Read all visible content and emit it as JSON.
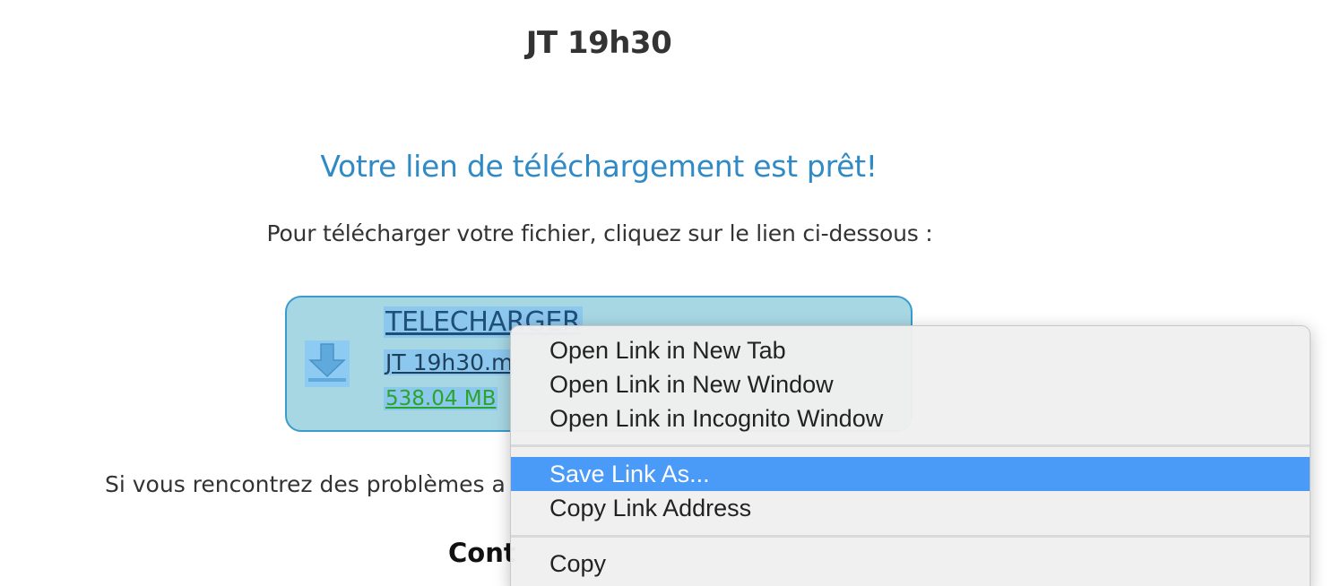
{
  "page": {
    "file_title": "JT 19h30",
    "ready_heading": "Votre lien de téléchargement est prêt!",
    "instructions": "Pour télécharger votre fichier, cliquez sur le lien ci-dessous :",
    "problems_text": "Si vous rencontrez des problèmes a",
    "contact_text": "Cont"
  },
  "download": {
    "link_label": "TELECHARGER",
    "file_name": "JT 19h30.m",
    "file_size": "538.04 MB",
    "icon": "download-arrow-icon"
  },
  "context_menu": {
    "items": [
      {
        "label": "Open Link in New Tab"
      },
      {
        "label": "Open Link in New Window"
      },
      {
        "label": "Open Link in Incognito Window"
      },
      {
        "label": "Save Link As..."
      },
      {
        "label": "Copy Link Address"
      },
      {
        "label": "Copy"
      }
    ],
    "highlighted_item": "Save Link As..."
  },
  "colors": {
    "heading_blue": "#2f8ac5",
    "box_background": "#a7d7e3",
    "box_border": "#3a9bcd",
    "selection": "#8cc7ee",
    "size_green": "#2aa52a",
    "menu_highlight": "#4a9af8"
  }
}
